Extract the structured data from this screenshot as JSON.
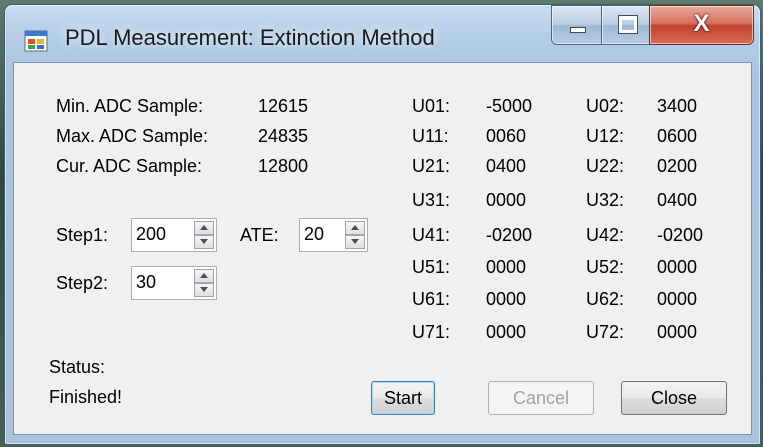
{
  "window": {
    "title": "PDL Measurement: Extinction Method",
    "close_glyph": "X"
  },
  "adc": [
    {
      "label": "Min. ADC Sample:",
      "value": "12615"
    },
    {
      "label": "Max. ADC Sample:",
      "value": "24835"
    },
    {
      "label": "Cur. ADC Sample:",
      "value": "12800"
    }
  ],
  "controls": {
    "step1": {
      "label": "Step1:",
      "value": "200"
    },
    "ate": {
      "label": "ATE:",
      "value": "20"
    },
    "step2": {
      "label": "Step2:",
      "value": "30"
    }
  },
  "voltages": [
    {
      "l1": "U01:",
      "v1": "-5000",
      "l2": "U02:",
      "v2": "3400"
    },
    {
      "l1": "U11:",
      "v1": "0060",
      "l2": "U12:",
      "v2": "0600"
    },
    {
      "l1": "U21:",
      "v1": "0400",
      "l2": "U22:",
      "v2": "0200"
    },
    {
      "l1": "U31:",
      "v1": "0000",
      "l2": "U32:",
      "v2": "0400"
    },
    {
      "l1": "U41:",
      "v1": "-0200",
      "l2": "U42:",
      "v2": "-0200"
    },
    {
      "l1": "U51:",
      "v1": "0000",
      "l2": "U52:",
      "v2": "0000"
    },
    {
      "l1": "U61:",
      "v1": "0000",
      "l2": "U62:",
      "v2": "0000"
    },
    {
      "l1": "U71:",
      "v1": "0000",
      "l2": "U72:",
      "v2": "0000"
    }
  ],
  "status": {
    "label": "Status:",
    "value": "Finished!"
  },
  "buttons": {
    "start": "Start",
    "cancel": "Cancel",
    "close": "Close"
  },
  "icons": {
    "app": "window-app-icon",
    "minimize": "minimize-icon",
    "maximize": "maximize-icon",
    "close": "close-icon"
  }
}
